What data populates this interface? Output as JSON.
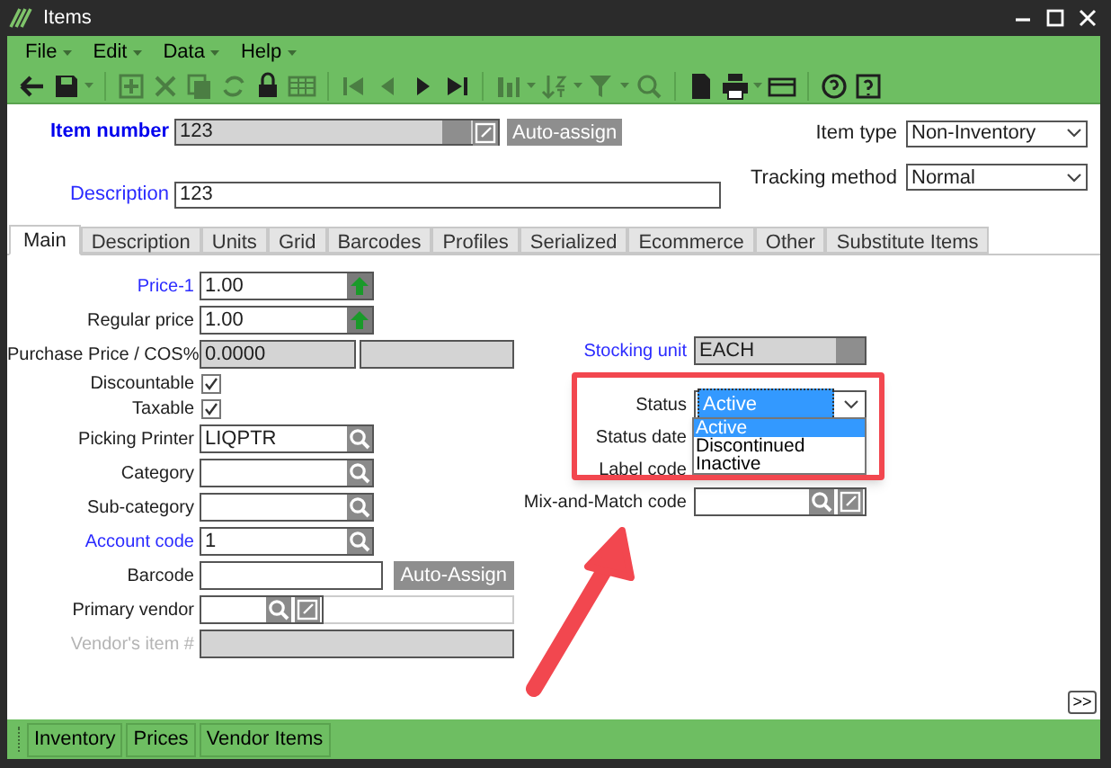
{
  "window": {
    "title": "Items"
  },
  "menu": [
    {
      "label": "File"
    },
    {
      "label": "Edit"
    },
    {
      "label": "Data"
    },
    {
      "label": "Help"
    }
  ],
  "header": {
    "item_number": {
      "label": "Item number",
      "value": "123",
      "button": "Auto-assign"
    },
    "item_type": {
      "label": "Item type",
      "value": "Non-Inventory"
    },
    "tracking_method": {
      "label": "Tracking method",
      "value": "Normal"
    },
    "description": {
      "label": "Description",
      "value": "123"
    }
  },
  "tabs": [
    {
      "label": "Main",
      "selected": true
    },
    {
      "label": "Description",
      "selected": false
    },
    {
      "label": "Units",
      "selected": false
    },
    {
      "label": "Grid",
      "selected": false
    },
    {
      "label": "Barcodes",
      "selected": false
    },
    {
      "label": "Profiles",
      "selected": false
    },
    {
      "label": "Serialized",
      "selected": false
    },
    {
      "label": "Ecommerce",
      "selected": false
    },
    {
      "label": "Other",
      "selected": false
    },
    {
      "label": "Substitute Items",
      "selected": false
    }
  ],
  "left_fields": [
    {
      "kind": "price",
      "label": "Price-1",
      "value": "1.00",
      "highlighted": true,
      "disabled": false
    },
    {
      "kind": "price",
      "label": "Regular price",
      "value": "1.00",
      "highlighted": false,
      "disabled": false
    },
    {
      "kind": "pair",
      "label": "Purchase Price / COS%",
      "value": "0.0000",
      "highlighted": false,
      "disabled": false
    },
    {
      "kind": "checkbox",
      "label": "Discountable",
      "checked": true,
      "highlighted": false,
      "disabled": false
    },
    {
      "kind": "checkbox",
      "label": "Taxable",
      "checked": true,
      "highlighted": false,
      "disabled": false
    },
    {
      "kind": "lookup",
      "label": "Picking Printer",
      "value": "LIQPTR",
      "highlighted": false,
      "disabled": false
    },
    {
      "kind": "lookup",
      "label": "Category",
      "highlighted": false,
      "disabled": false
    },
    {
      "kind": "lookup",
      "label": "Sub-category",
      "highlighted": false,
      "disabled": false
    },
    {
      "kind": "lookup",
      "label": "Account code",
      "value": "1",
      "highlighted": true,
      "disabled": false
    },
    {
      "kind": "button",
      "label": "Barcode",
      "button": "Auto-Assign",
      "highlighted": false,
      "disabled": false
    },
    {
      "kind": "vendor",
      "label": "Primary vendor",
      "highlighted": false,
      "disabled": false
    },
    {
      "kind": "text",
      "label": "Vendor's item #",
      "highlighted": false,
      "disabled": true
    }
  ],
  "right_fields": [
    {
      "kind": "unit",
      "label": "Stocking unit",
      "value": "EACH",
      "highlighted": true
    },
    {
      "kind": "status",
      "label": "Status",
      "value": "Active",
      "highlighted": false,
      "options": [
        {
          "label": "Active",
          "selected": true
        },
        {
          "label": "Discontinued",
          "selected": false
        },
        {
          "label": "Inactive",
          "selected": false
        }
      ]
    },
    {
      "kind": "label",
      "label": "Status date",
      "highlighted": false
    },
    {
      "kind": "label",
      "label": "Label code",
      "highlighted": false
    },
    {
      "kind": "lookup_edit",
      "label": "Mix-and-Match code",
      "highlighted": false
    }
  ],
  "more_button": ">>",
  "bottom_tabs": [
    {
      "label": "Inventory"
    },
    {
      "label": "Prices"
    },
    {
      "label": "Vendor Items"
    }
  ]
}
